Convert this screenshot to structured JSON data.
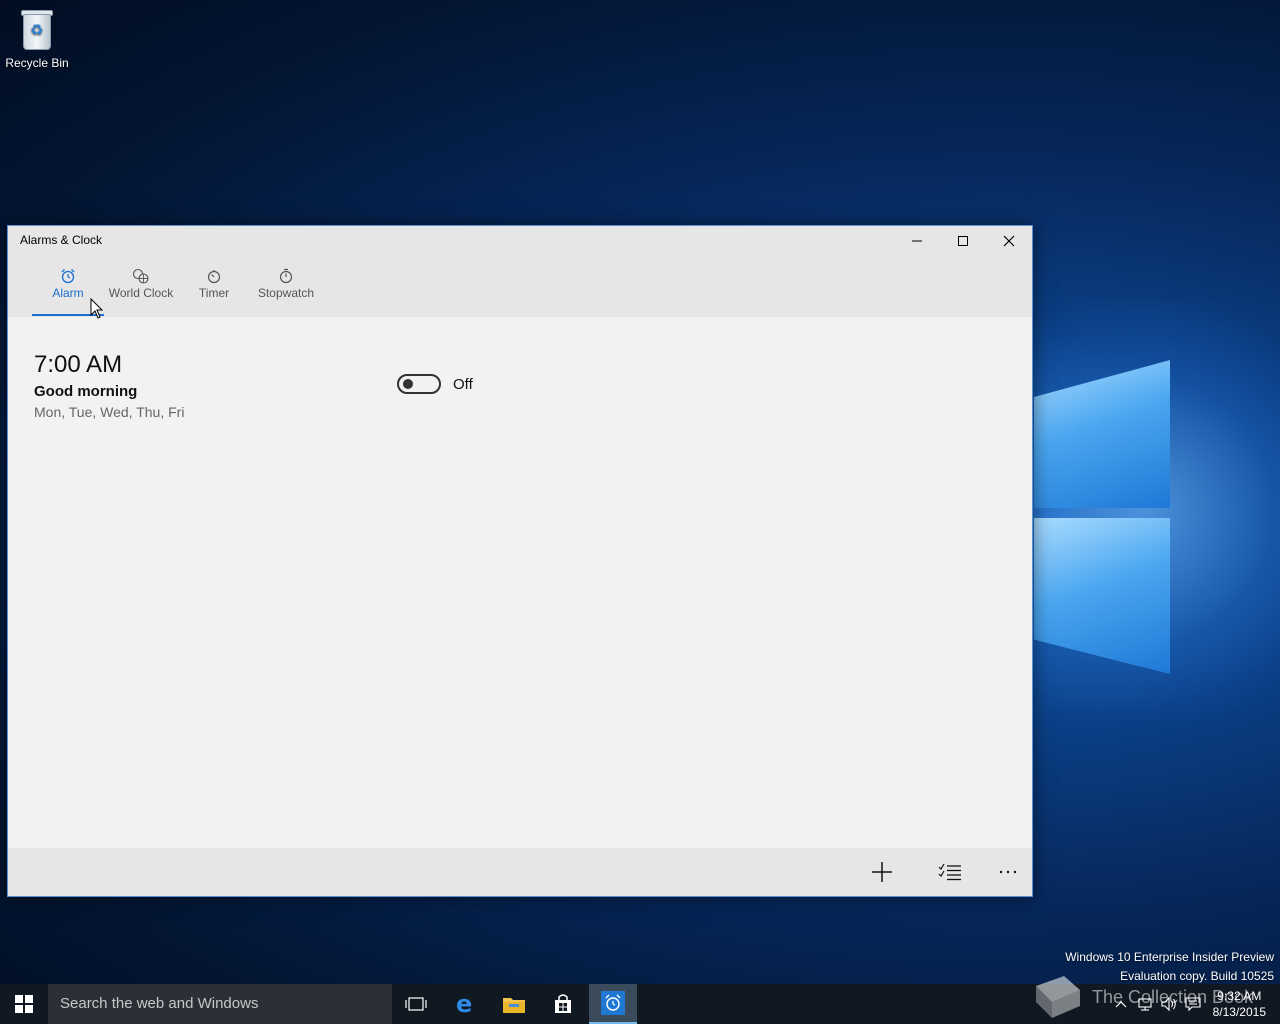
{
  "desktop": {
    "recycle_bin_label": "Recycle Bin"
  },
  "window": {
    "title": "Alarms & Clock",
    "tabs": [
      {
        "label": "Alarm",
        "icon": "alarm-clock-icon",
        "active": true
      },
      {
        "label": "World Clock",
        "icon": "world-clock-icon",
        "active": false
      },
      {
        "label": "Timer",
        "icon": "timer-icon",
        "active": false
      },
      {
        "label": "Stopwatch",
        "icon": "stopwatch-icon",
        "active": false
      }
    ],
    "alarms": [
      {
        "time": "7:00 AM",
        "name": "Good morning",
        "days": "Mon, Tue, Wed, Thu, Fri",
        "state_label": "Off",
        "enabled": false
      }
    ],
    "commands": [
      "add-icon",
      "select-alarms-icon",
      "more-icon"
    ]
  },
  "watermark": {
    "line1": "Windows 10 Enterprise Insider Preview",
    "line2": "Evaluation copy. Build 10525"
  },
  "overlay_text": "The Collection Book",
  "taskbar": {
    "search_placeholder": "Search the web and Windows",
    "clock_time": "9:32 AM",
    "clock_date": "8/13/2015"
  },
  "colors": {
    "accent": "#1a6fd0",
    "taskbar": "#101822",
    "window_bg": "#f2f2f2"
  }
}
